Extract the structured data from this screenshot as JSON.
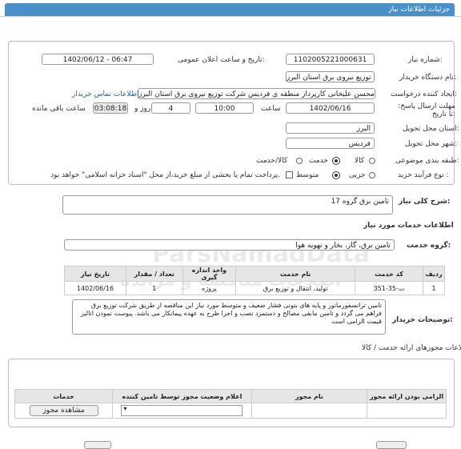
{
  "header": {
    "title": "جزئیات اطلاعات نیاز"
  },
  "fields": {
    "need_number_label": "شماره نیاز:",
    "need_number": "1102005221000631",
    "announce_label": "تاریخ و ساعت اعلان عمومی:",
    "announce_value": "1402/06/12 - 06:47",
    "buyer_label": "نام دستگاه خریدار:",
    "buyer_value": "شرکت توزیع نیروی برق استان البرز",
    "creator_label": "ایجاد کننده درخواست:",
    "creator_value": "محسن علیخانی کارپرداز منطقه ی فردیس شرکت توزیع نیروی برق استان البرز",
    "contact_link": "اطلاعات تماس خریدار",
    "deadline_label": "مهلت ارسال پاسخ: تا تاریخ:",
    "deadline_date": "1402/06/16",
    "hour_label": "ساعت",
    "deadline_time": "10:00",
    "days_value": "4",
    "days_label": "روز و",
    "remaining_time": "03:08:18",
    "remaining_label": "ساعت باقی مانده",
    "province_label": "استان محل تحویل:",
    "province_value": "البرز",
    "city_label": "شهر محل تحویل:",
    "city_value": "فردیس",
    "category_label": "طبقه بندی موضوعی:",
    "category_options": [
      "کالا",
      "خدمت",
      "کالا/خدمت"
    ],
    "process_label": "نوع فرآیند خرید :",
    "process_options": [
      "جزیی",
      "متوسط"
    ],
    "payment_note": "پرداخت تمام یا بخشی از مبلغ خرید،از محل \"اسناد خزانه اسلامی\" خواهد بود."
  },
  "summary": {
    "label": "شرح کلی نیاز:",
    "value": "تامین برق گروه 17"
  },
  "services": {
    "title": "اطلاعات خدمات مورد نیاز",
    "group_label": "گروه خدمت:",
    "group_value": "تامین برق، گاز، بخار و تهویه هوا"
  },
  "table": {
    "headers": [
      "ردیف",
      "کد خدمت",
      "نام خدمت",
      "واحد اندازه گیری",
      "تعداد / مقدار",
      "تاریخ نیاز"
    ],
    "rows": [
      [
        "1",
        "ت-35-351",
        "تولید، انتقال و توزیع برق",
        "پروژه",
        "1",
        "1402/06/16"
      ]
    ]
  },
  "buyer_notes": {
    "label": "توضیحات خریدار:",
    "text": "تامین ترانسفورماتور و پایه های بتونی فشار ضعیف و متوسط مورد نیاز این مناقصه از طریق شرکت توزیع برق فراهم می گردد و تامین مابقی مصالح و دستمزد نصب و اجرا طرح به عهده پیمانکار می باشد. پیوست نمودن انالیز قیمت الزامی است"
  },
  "permits": {
    "title": "اطلاعات مجوزهای ارائه خدمت / کالا",
    "headers": [
      "الزامی بودن ارائه مجوز",
      "نام مجوز",
      "اعلام وضعیت مجوز توسط تامین کننده",
      "خدمات"
    ],
    "view_button": "مشاهده مجوز"
  },
  "watermark": {
    "line1": "ParsNamadData",
    "line2": "اطلاعات مناقصه و مزایده"
  }
}
